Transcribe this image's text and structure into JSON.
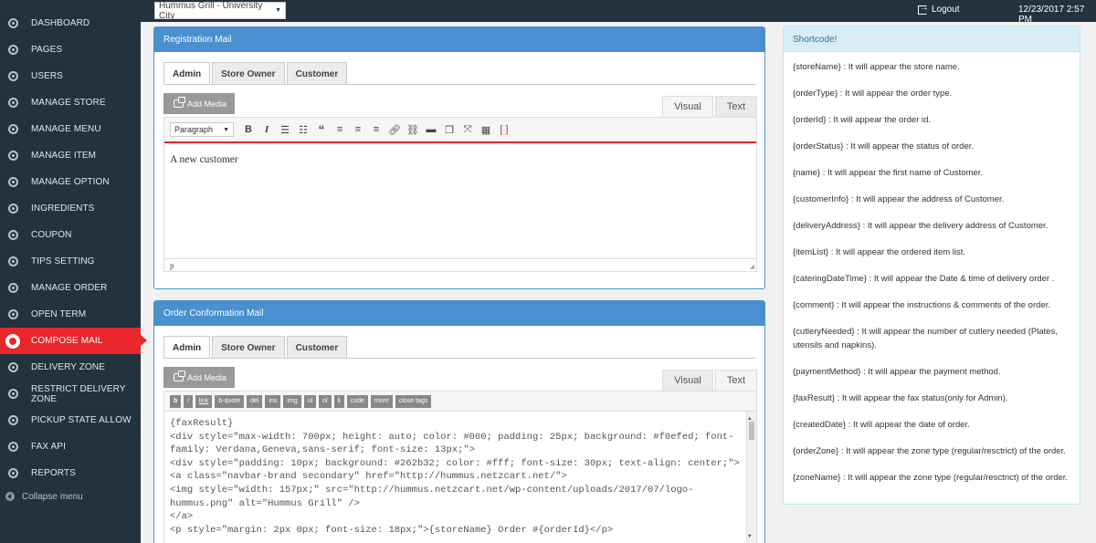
{
  "topbar": {
    "store_select": "Hummus Grill - University City",
    "logout": "Logout",
    "datetime": "12/23/2017 2:57 PM"
  },
  "sidebar": {
    "items": [
      {
        "label": "DASHBOARD",
        "icon": "gear-icon"
      },
      {
        "label": "PAGES",
        "icon": "gear-icon"
      },
      {
        "label": "USERS",
        "icon": "gear-icon"
      },
      {
        "label": "MANAGE STORE",
        "icon": "gear-icon"
      },
      {
        "label": "MANAGE MENU",
        "icon": "gear-icon"
      },
      {
        "label": "MANAGE ITEM",
        "icon": "gear-icon"
      },
      {
        "label": "MANAGE OPTION",
        "icon": "gear-icon"
      },
      {
        "label": "INGREDIENTS",
        "icon": "gear-icon"
      },
      {
        "label": "COUPON",
        "icon": "gear-icon"
      },
      {
        "label": "TIPS SETTING",
        "icon": "gear-icon"
      },
      {
        "label": "MANAGE ORDER",
        "icon": "gear-icon"
      },
      {
        "label": "OPEN TERM",
        "icon": "gear-icon"
      },
      {
        "label": "COMPOSE MAIL",
        "icon": "gear-icon",
        "active": true
      },
      {
        "label": "DELIVERY ZONE",
        "icon": "gear-icon"
      },
      {
        "label": "RESTRICT DELIVERY ZONE",
        "icon": "gear-icon"
      },
      {
        "label": "PICKUP STATE ALLOW",
        "icon": "gear-icon"
      },
      {
        "label": "FAX API",
        "icon": "gear-icon"
      },
      {
        "label": "REPORTS",
        "icon": "gear-icon"
      }
    ],
    "collapse": "Collapse menu",
    "active_color": "#e8262b"
  },
  "registration": {
    "title": "Registration Mail",
    "tabs": [
      "Admin",
      "Store Owner",
      "Customer"
    ],
    "add_media": "Add Media",
    "visual": "Visual",
    "text": "Text",
    "format": "Paragraph",
    "content": "A new customer",
    "path": "p"
  },
  "conformation": {
    "title": "Order Conformation Mail",
    "tabs": [
      "Admin",
      "Store Owner",
      "Customer"
    ],
    "add_media": "Add Media",
    "visual": "Visual",
    "text": "Text",
    "quicktags": [
      "b",
      "i",
      "link",
      "b-quote",
      "del",
      "ins",
      "img",
      "ul",
      "ol",
      "li",
      "code",
      "more",
      "close tags"
    ],
    "code_lines": [
      "{faxResult}",
      "<div style=\"max-width: 700px; height: auto; color: #000; padding: 25px; background: #f0efed; font-family: Verdana,Geneva,sans-serif; font-size: 13px;\">",
      "<div style=\"padding: 10px; background: #262b32; color: #fff; font-size: 30px; text-align: center;\"><a class=\"navbar-brand secondary\" href=\"http://hummus.netzcart.net/\">",
      "<img style=\"width: 157px;\" src=\"http://hummus.netzcart.net/wp-content/uploads/2017/07/logo-hummus.png\" alt=\"Hummus Grill\" />",
      "</a>",
      "<p style=\"margin: 2px 0px; font-size: 18px;\">{storeName} Order #{orderId}</p>"
    ]
  },
  "shortcode": {
    "title": "Shortcode!",
    "items": [
      "{storeName} : It will appear the store name.",
      "{orderType} : It will appear the order type.",
      "{orderId} : It will appear the order id.",
      "{orderStatus} : It will appear the status of order.",
      "{name} : It will appear the first name of Customer.",
      "{customerInfo} : It will appear the address of Customer.",
      "{deliveryAddress} : It will appear the delivery address of Customer.",
      "{itemList} : It will appear the ordered item list.",
      "{cateringDateTime} : It will appear the Date & time of delivery order .",
      "{comment} : It will appear the instructions & comments of the order.",
      "{cutleryNeeded} : It will appear the number of cutlery needed (Plates, utensils and napkins).",
      "{paymentMethod} : It will appear the payment method.",
      "{faxResult} : It will appear the fax status(only for Admin).",
      "{createdDate} : It will appear the date of order.",
      "{orderZone} : It will appear the zone type (regular/resctrict) of the order.",
      "{zoneName} : It will appear the zone type (regular/resctrict) of the order."
    ]
  },
  "colors": {
    "sidebar_bg": "#23323f",
    "panel_header": "#4a8fd0",
    "shortcode_header": "#d9edf7"
  }
}
